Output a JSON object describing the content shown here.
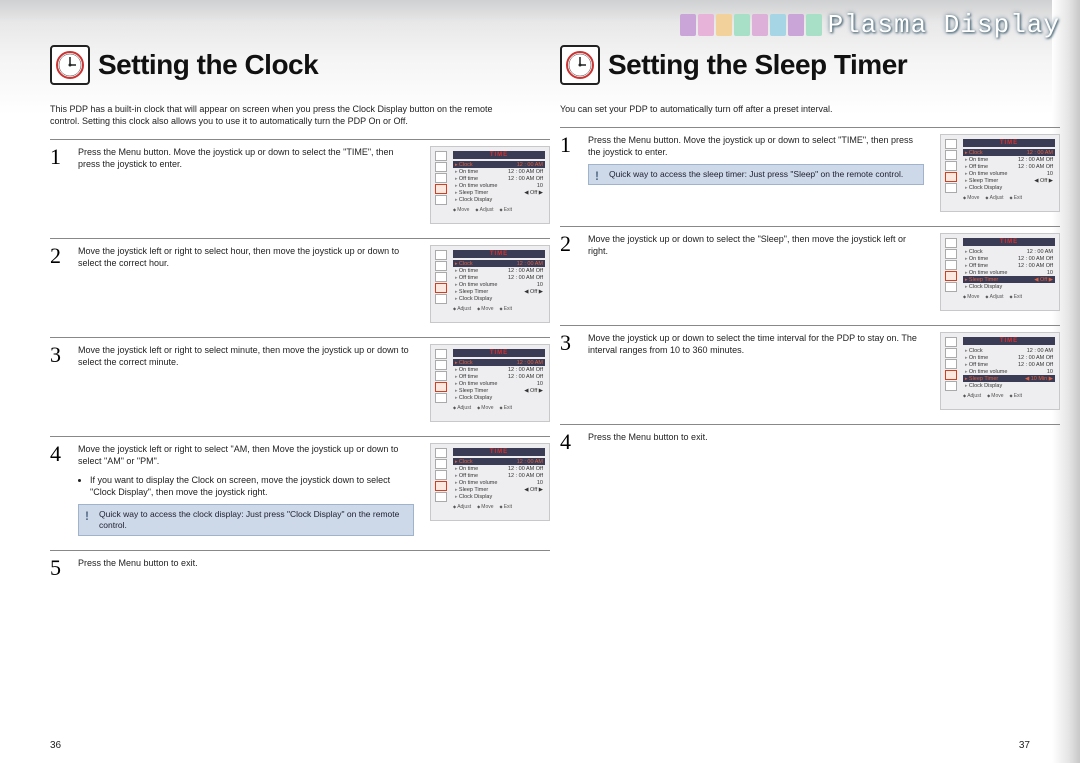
{
  "brand": "Plasma Display",
  "left": {
    "title": "Setting the Clock",
    "intro": "This PDP has a built-in clock that will appear on screen when you press the Clock Display button on the remote control. Setting this clock also allows you to use it to automatically turn the PDP On or Off.",
    "steps": [
      {
        "num": "1",
        "text": "Press the Menu button. Move the joystick up or down to select the \"TIME\", then press the joystick to enter."
      },
      {
        "num": "2",
        "text": "Move the joystick left or right to select hour, then move the joystick up or down to select the correct hour."
      },
      {
        "num": "3",
        "text": "Move the joystick left or right to select minute, then move the joystick up or down to select the correct minute."
      },
      {
        "num": "4",
        "text": "Move the joystick left or right to select \"AM, then Move the joystick up or down to select \"AM\" or \"PM\".",
        "bullet": "If you want to display the Clock on screen, move the joystick down to select \"Clock Display\", then move the joystick right.",
        "tip": "Quick way to access the clock display: Just press \"Clock Display\" on the remote control."
      },
      {
        "num": "5",
        "text": "Press the Menu button to exit."
      }
    ],
    "page_num": "36"
  },
  "right": {
    "title": "Setting the Sleep Timer",
    "intro": "You can set your PDP to automatically turn off after a preset interval.",
    "steps": [
      {
        "num": "1",
        "text": "Press the Menu button. Move the joystick up or down to select \"TIME\", then press the joystick to enter.",
        "tip": "Quick way to access the sleep timer: Just press \"Sleep\" on the remote control."
      },
      {
        "num": "2",
        "text": "Move the joystick up or down to select the \"Sleep\", then move the joystick left or right."
      },
      {
        "num": "3",
        "text": "Move the joystick up or down to select the time interval for the PDP to stay on. The interval ranges from 10 to 360 minutes."
      },
      {
        "num": "4",
        "text": "Press the Menu button to exit."
      }
    ],
    "page_num": "37"
  },
  "osd": {
    "title": "TIME",
    "rows": [
      {
        "label": "Clock",
        "val": "12 : 00  AM"
      },
      {
        "label": "On time",
        "val": "12 : 00  AM  Off"
      },
      {
        "label": "Off time",
        "val": "12 : 00  AM  Off"
      },
      {
        "label": "On time volume",
        "val": "10"
      },
      {
        "label": "Sleep Timer",
        "val": "◀   Off   ▶"
      },
      {
        "label": "Clock Display",
        "val": ""
      }
    ],
    "foot1": [
      "Move",
      "Adjust",
      "Exit"
    ],
    "foot2": [
      "Adjust",
      "Move",
      "Exit"
    ],
    "sleep_val_alt": "◀  10 Min  ▶"
  }
}
